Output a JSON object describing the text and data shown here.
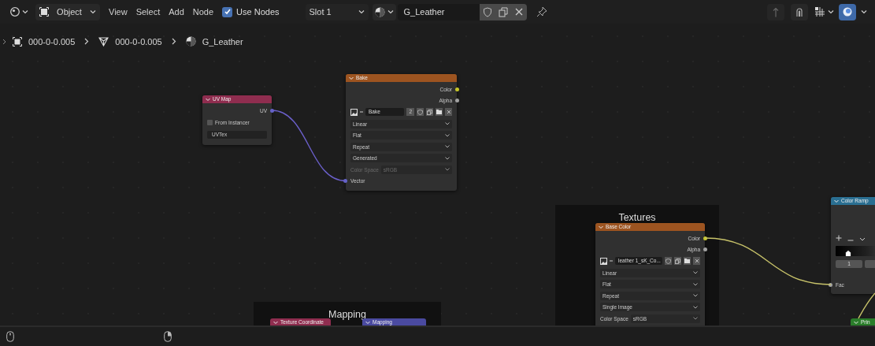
{
  "header": {
    "mode": "Object",
    "menus": [
      "View",
      "Select",
      "Add",
      "Node"
    ],
    "use_nodes": {
      "label": "Use Nodes",
      "checked": true
    },
    "slot": "Slot 1",
    "material": "G_Leather"
  },
  "breadcrumb": [
    {
      "kind": "object",
      "label": "000-0-0.005"
    },
    {
      "kind": "mesh",
      "label": "000-0-0.005"
    },
    {
      "kind": "material",
      "label": "G_Leather"
    }
  ],
  "frames": [
    {
      "label": "Textures"
    },
    {
      "label": "Mapping"
    }
  ],
  "nodes": [
    {
      "title": "UV Map",
      "color": "#8f2d4f",
      "rows": [
        {
          "kind": "output",
          "label": "UV",
          "color": "#6363c7"
        },
        {
          "kind": "checkbox",
          "label": "From Instancer",
          "checked": false
        },
        {
          "kind": "field",
          "value": "UVTex"
        }
      ]
    },
    {
      "title": "Bake",
      "color": "#9d5420",
      "rows": [
        {
          "kind": "output",
          "label": "Color",
          "color": "#c7c729"
        },
        {
          "kind": "output",
          "label": "Alpha",
          "color": "#a1a1a1"
        },
        {
          "kind": "image",
          "value": "Bake",
          "users": "2"
        },
        {
          "kind": "dropdown",
          "value": "Linear"
        },
        {
          "kind": "dropdown",
          "value": "Flat"
        },
        {
          "kind": "dropdown",
          "value": "Repeat"
        },
        {
          "kind": "dropdown",
          "value": "Generated"
        },
        {
          "kind": "labeled",
          "label": "Color Space",
          "value": "sRGB",
          "disabled": true
        },
        {
          "kind": "input",
          "label": "Vector",
          "color": "#6363c7"
        }
      ]
    },
    {
      "title": "Base Color",
      "color": "#9d5420",
      "rows": [
        {
          "kind": "output",
          "label": "Color",
          "color": "#c7c729"
        },
        {
          "kind": "output",
          "label": "Alpha",
          "color": "#a1a1a1"
        },
        {
          "kind": "image",
          "value": "leather 1_sK_Co..."
        },
        {
          "kind": "dropdown",
          "value": "Linear"
        },
        {
          "kind": "dropdown",
          "value": "Flat"
        },
        {
          "kind": "dropdown",
          "value": "Repeat"
        },
        {
          "kind": "dropdown",
          "value": "Single Image"
        },
        {
          "kind": "labeled",
          "label": "Color Space",
          "value": "sRGB",
          "disabled": false
        }
      ]
    },
    {
      "title": "Color Ramp",
      "color": "#2a6f92",
      "rows": [
        {
          "kind": "controls"
        },
        {
          "kind": "ramp"
        },
        {
          "kind": "stop",
          "value": "1"
        },
        {
          "kind": "input",
          "label": "Fac",
          "color": "#a1a1a1"
        }
      ]
    },
    {
      "title": "Texture Coordinate",
      "color": "#8f2d4f"
    },
    {
      "title": "Mapping",
      "color": "#4a4aa0"
    },
    {
      "title": "Prin",
      "color": "#2a7d2a"
    }
  ]
}
